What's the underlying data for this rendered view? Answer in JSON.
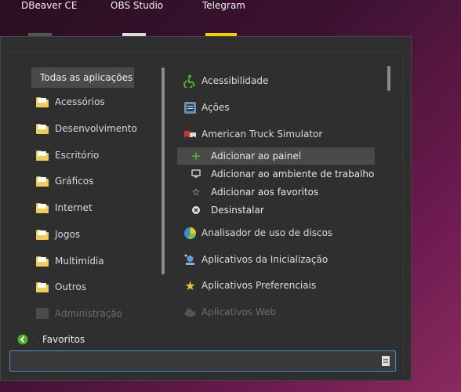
{
  "taskbar": {
    "apps": [
      "DBeaver CE",
      "OBS Studio",
      "Telegram"
    ]
  },
  "categories": {
    "header": "Todas as aplicações",
    "items": [
      {
        "label": "Acessórios",
        "icon": "folder-icon"
      },
      {
        "label": "Desenvolvimento",
        "icon": "folder-icon"
      },
      {
        "label": "Escritório",
        "icon": "folder-icon"
      },
      {
        "label": "Gráficos",
        "icon": "folder-icon"
      },
      {
        "label": "Internet",
        "icon": "folder-icon"
      },
      {
        "label": "Jogos",
        "icon": "folder-icon"
      },
      {
        "label": "Multimídia",
        "icon": "folder-icon"
      },
      {
        "label": "Outros",
        "icon": "folder-icon"
      },
      {
        "label": "Administração",
        "icon": "admin-icon",
        "disabled": true
      }
    ]
  },
  "applications": {
    "items": [
      {
        "label": "Acessibilidade",
        "icon": "accessibility-icon"
      },
      {
        "label": "Ações",
        "icon": "actions-icon"
      },
      {
        "label": "American Truck Simulator",
        "icon": "truck-icon"
      },
      {
        "label": "Analisador de uso de discos",
        "icon": "disk-usage-icon"
      },
      {
        "label": "Aplicativos da Inicialização",
        "icon": "startup-apps-icon"
      },
      {
        "label": "Aplicativos Preferenciais",
        "icon": "star-icon"
      },
      {
        "label": "Aplicativos Web",
        "icon": "cloud-icon",
        "disabled": true
      }
    ],
    "context_actions": [
      {
        "label": "Adicionar ao painel",
        "icon": "plus-icon"
      },
      {
        "label": "Adicionar ao ambiente de trabalho",
        "icon": "desktop-icon"
      },
      {
        "label": "Adicionar aos favoritos",
        "icon": "star-outline-icon"
      },
      {
        "label": "Desinstalar",
        "icon": "uninstall-icon"
      }
    ]
  },
  "favorites": {
    "label": "Favoritos"
  },
  "search": {
    "value": "",
    "placeholder": ""
  },
  "colors": {
    "accent_green": "#4caf2a",
    "search_border": "#3d8fc9",
    "highlight": "#4a4a4a"
  }
}
